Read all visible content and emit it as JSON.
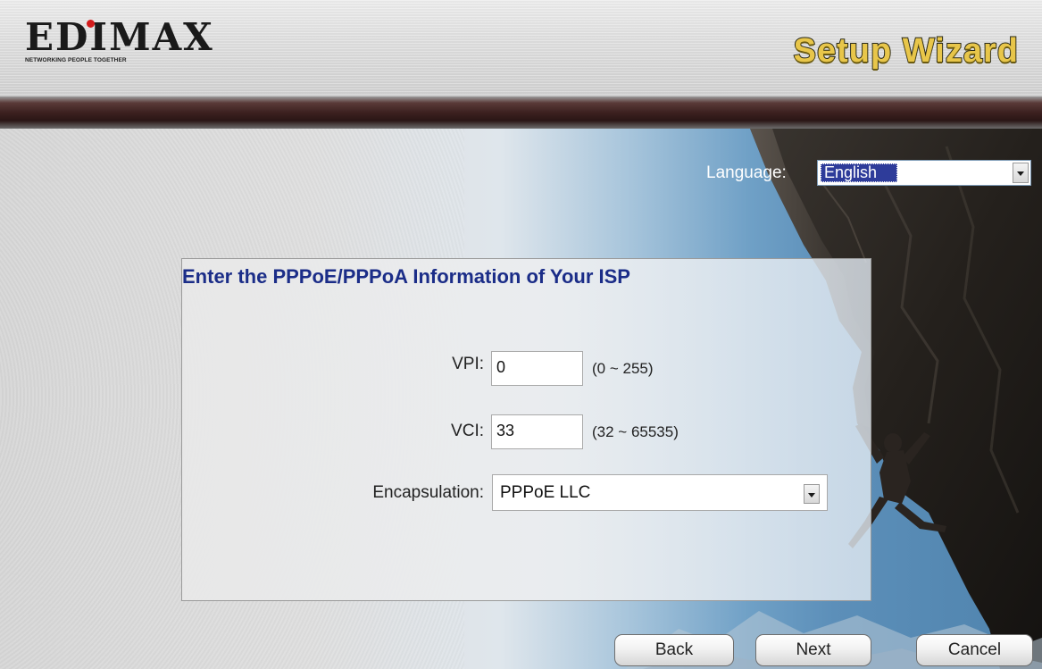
{
  "header": {
    "logo_text": "EDIMAX",
    "logo_tagline": "NETWORKING PEOPLE TOGETHER",
    "title": "Setup Wizard"
  },
  "language": {
    "label": "Language:",
    "selected": "English"
  },
  "panel": {
    "title": "Enter the PPPoE/PPPoA Information of Your ISP",
    "vpi": {
      "label": "VPI:",
      "value": "0",
      "hint": "(0 ~ 255)"
    },
    "vci": {
      "label": "VCI:",
      "value": "33",
      "hint": "(32 ~ 65535)"
    },
    "encapsulation": {
      "label": "Encapsulation:",
      "selected": "PPPoE LLC"
    }
  },
  "buttons": {
    "back": "Back",
    "next": "Next",
    "cancel": "Cancel"
  },
  "colors": {
    "title_blue": "#1b2d88",
    "wizard_gold": "#e8c64a",
    "selection_blue": "#2e3c9a"
  }
}
